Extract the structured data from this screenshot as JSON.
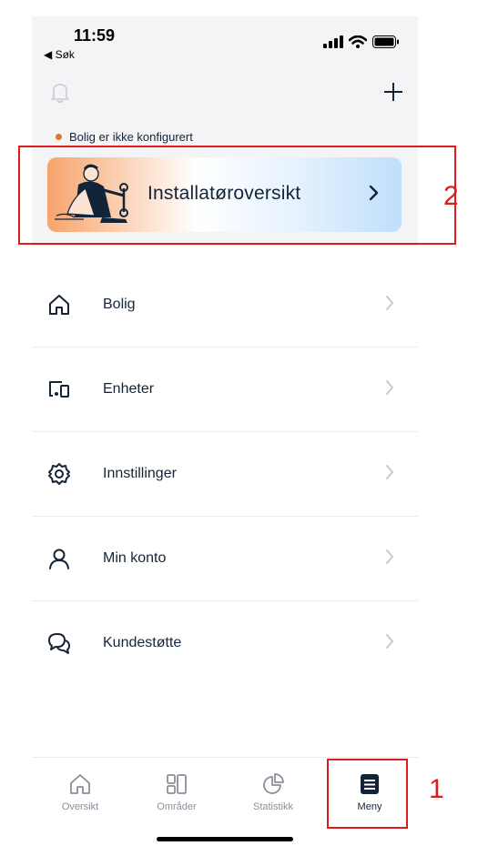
{
  "status_bar": {
    "time": "11:59",
    "back_label": "◀ Søk"
  },
  "home_status": {
    "text": "Bolig er ikke konfigurert",
    "dot_color": "#e5742b"
  },
  "banner": {
    "title": "Installatøroversikt"
  },
  "menu": {
    "items": [
      {
        "label": "Bolig",
        "icon": "house-icon"
      },
      {
        "label": "Enheter",
        "icon": "devices-icon"
      },
      {
        "label": "Innstillinger",
        "icon": "gear-icon"
      },
      {
        "label": "Min konto",
        "icon": "person-icon"
      },
      {
        "label": "Kundestøtte",
        "icon": "chat-bubbles-icon"
      }
    ]
  },
  "tabbar": {
    "tabs": [
      {
        "label": "Oversikt",
        "icon": "house-icon",
        "active": false
      },
      {
        "label": "Områder",
        "icon": "grid-icon",
        "active": false
      },
      {
        "label": "Statistikk",
        "icon": "pie-chart-icon",
        "active": false
      },
      {
        "label": "Meny",
        "icon": "menu-icon",
        "active": true
      }
    ]
  },
  "annotations": {
    "marker_1": "1",
    "marker_2": "2",
    "color": "#e01b1b"
  }
}
